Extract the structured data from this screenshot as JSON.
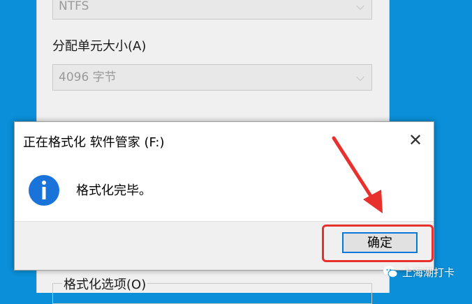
{
  "background_window": {
    "filesystem_value": "NTFS",
    "allocation_label": "分配单元大小(A)",
    "allocation_value": "4096 字节",
    "format_options_label": "格式化选项(O)"
  },
  "dialog": {
    "title": "正在格式化 软件管家 (F:)",
    "message": "格式化完毕。",
    "ok_label": "确定",
    "close_glyph": "✕"
  },
  "watermark": {
    "text": "上海潮打卡"
  },
  "colors": {
    "desktop": "#0a8fd8",
    "info_icon": "#1a73d9",
    "annotation": "#e8302c",
    "focus_border": "#0078d7"
  },
  "icons": [
    "chevron-down-icon",
    "info-icon",
    "close-icon",
    "wechat-icon",
    "arrow-annotation"
  ]
}
